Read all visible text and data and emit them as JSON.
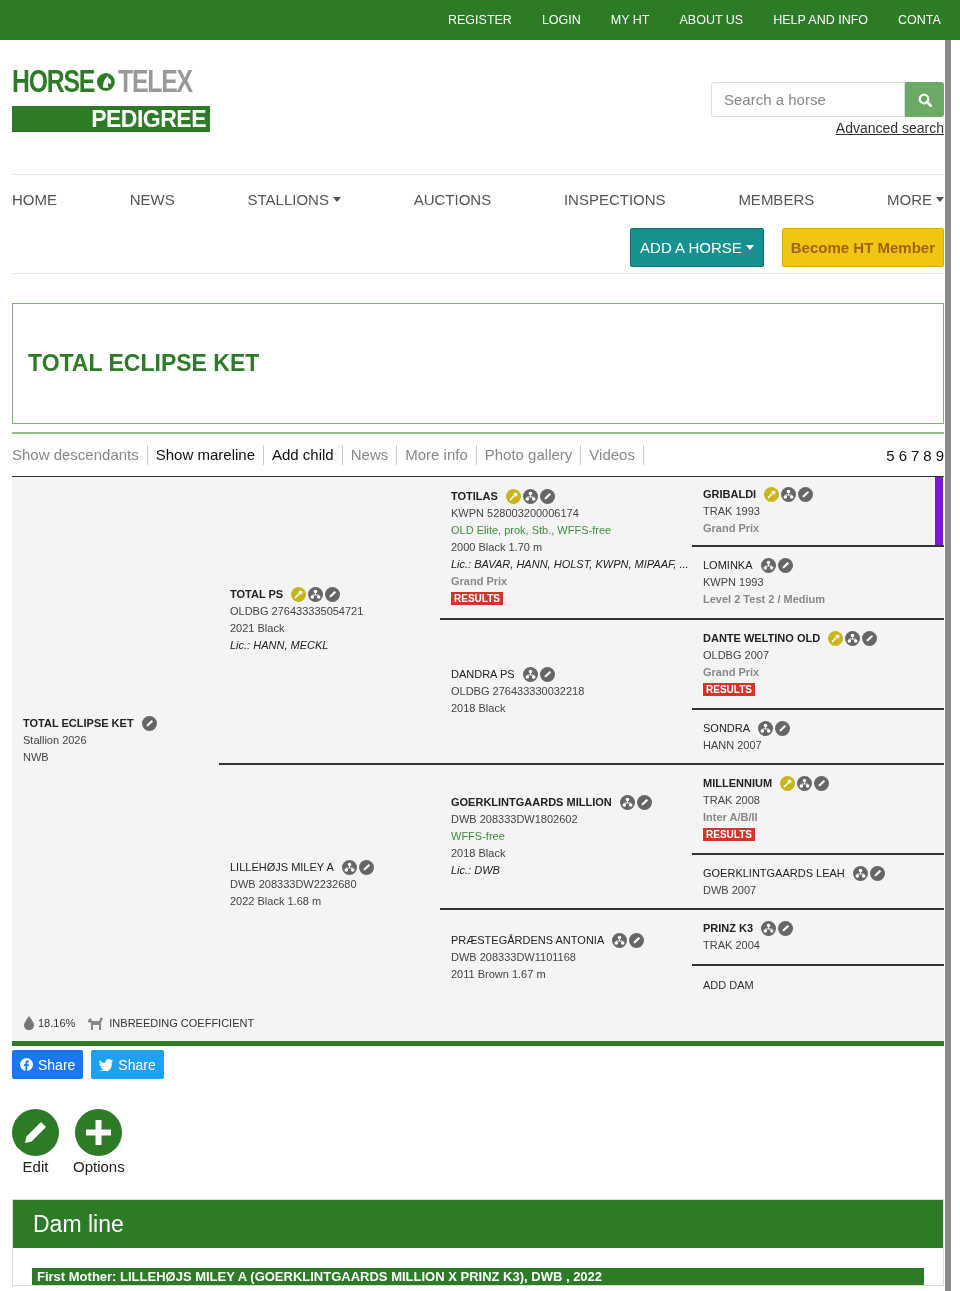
{
  "top_links": [
    "REGISTER",
    "LOGIN",
    "MY HT",
    "ABOUT US",
    "HELP AND INFO",
    "CONTA"
  ],
  "logo": {
    "word_1": "HORSE",
    "word_2": "TELEX",
    "tagline": "PEDIGREE"
  },
  "search": {
    "placeholder": "Search a horse",
    "advanced_link": "Advanced search"
  },
  "nav": [
    {
      "label": "HOME",
      "has_menu": false
    },
    {
      "label": "NEWS",
      "has_menu": false
    },
    {
      "label": "STALLIONS",
      "has_menu": true
    },
    {
      "label": "AUCTIONS",
      "has_menu": false
    },
    {
      "label": "INSPECTIONS",
      "has_menu": false
    },
    {
      "label": "MEMBERS",
      "has_menu": false
    },
    {
      "label": "MORE",
      "has_menu": true
    }
  ],
  "actions": [
    {
      "label": "ADD A HORSE",
      "kind": "primary",
      "has_menu": true
    },
    {
      "label": "Become HT Member",
      "kind": "member",
      "has_menu": false
    }
  ],
  "title": "TOTAL ECLIPSE KET",
  "tabs": [
    {
      "label": "Show descendants",
      "disabled": true
    },
    {
      "label": "Show mareline",
      "disabled": false
    },
    {
      "label": "Add child",
      "disabled": false
    },
    {
      "label": "News",
      "disabled": true
    },
    {
      "label": "More info",
      "disabled": true
    },
    {
      "label": "Photo gallery",
      "disabled": true
    },
    {
      "label": "Videos",
      "disabled": true
    }
  ],
  "generations": [
    "5",
    "6",
    "7",
    "8",
    "9"
  ],
  "pedigree": {
    "horse": {
      "kind": "stallion",
      "name": "TOTAL ECLIPSE KET",
      "approved": false,
      "offspring": false,
      "lines": [
        {
          "text": "Stallion 2026",
          "kind": "plain"
        },
        {
          "text": "NWB",
          "kind": "plain"
        }
      ],
      "children": [
        {
          "kind": "stallion",
          "name": "TOTAL PS",
          "approved": true,
          "offspring": true,
          "lines": [
            {
              "text": "OLDBG 276433335054721",
              "kind": "plain"
            },
            {
              "text": "2021 Black",
              "kind": "plain"
            },
            {
              "text": "Lic.: HANN, MECKL",
              "kind": "licence"
            }
          ],
          "children": [
            {
              "kind": "stallion",
              "name": "TOTILAS",
              "approved": true,
              "offspring": true,
              "lines": [
                {
                  "text": "KWPN 528003200006174",
                  "kind": "plain"
                },
                {
                  "text": "OLD Elite, prok, Stb., WFFS-free",
                  "kind": "predicate"
                },
                {
                  "text": "2000 Black 1.70 m",
                  "kind": "plain"
                },
                {
                  "text": "Lic.: BAVAR, HANN, HOLST, KWPN, MIPAAF, ...",
                  "kind": "licence"
                },
                {
                  "text": "Grand Prix",
                  "kind": "discipline"
                }
              ],
              "results": "RESULTS",
              "children": [
                {
                  "kind": "stallion",
                  "name": "GRIBALDI",
                  "approved": true,
                  "offspring": true,
                  "color": "#7b16d2",
                  "lines": [
                    {
                      "text": "TRAK 1993",
                      "kind": "plain"
                    },
                    {
                      "text": "Grand Prix",
                      "kind": "discipline"
                    }
                  ]
                },
                {
                  "kind": "mare",
                  "name": "LOMINKA",
                  "approved": false,
                  "offspring": true,
                  "lines": [
                    {
                      "text": "KWPN 1993",
                      "kind": "plain"
                    },
                    {
                      "text": "Level 2 Test 2 / Medium",
                      "kind": "discipline"
                    }
                  ]
                }
              ]
            },
            {
              "kind": "mare",
              "name": "DANDRA PS",
              "approved": false,
              "offspring": true,
              "lines": [
                {
                  "text": "OLDBG 276433330032218",
                  "kind": "plain"
                },
                {
                  "text": "2018 Black",
                  "kind": "plain"
                }
              ],
              "children": [
                {
                  "kind": "stallion",
                  "name": "DANTE WELTINO OLD",
                  "approved": true,
                  "offspring": true,
                  "lines": [
                    {
                      "text": "OLDBG 2007",
                      "kind": "plain"
                    },
                    {
                      "text": "Grand Prix",
                      "kind": "discipline"
                    }
                  ],
                  "results": "RESULTS"
                },
                {
                  "kind": "mare",
                  "name": "SONDRA",
                  "approved": false,
                  "offspring": true,
                  "lines": [
                    {
                      "text": "HANN 2007",
                      "kind": "plain"
                    }
                  ]
                }
              ]
            }
          ]
        },
        {
          "kind": "mare",
          "name": "LILLEHØJS MILEY A",
          "approved": false,
          "offspring": true,
          "lines": [
            {
              "text": "DWB 208333DW2232680",
              "kind": "plain"
            },
            {
              "text": "2022 Black 1.68 m",
              "kind": "plain"
            }
          ],
          "children": [
            {
              "kind": "stallion",
              "name": "GOERKLINTGAARDS MILLION",
              "approved": false,
              "offspring": true,
              "lines": [
                {
                  "text": "DWB 208333DW1802602",
                  "kind": "plain"
                },
                {
                  "text": "WFFS-free",
                  "kind": "predicate"
                },
                {
                  "text": "2018 Black",
                  "kind": "plain"
                },
                {
                  "text": "Lic.: DWB",
                  "kind": "licence"
                }
              ],
              "children": [
                {
                  "kind": "stallion",
                  "name": "MILLENNIUM",
                  "approved": true,
                  "offspring": true,
                  "lines": [
                    {
                      "text": "TRAK 2008",
                      "kind": "plain"
                    },
                    {
                      "text": "Inter A/B/II",
                      "kind": "discipline"
                    }
                  ],
                  "results": "RESULTS"
                },
                {
                  "kind": "mare",
                  "name": "GOERKLINTGAARDS LEAH",
                  "approved": false,
                  "offspring": true,
                  "lines": [
                    {
                      "text": "DWB 2007",
                      "kind": "plain"
                    }
                  ]
                }
              ]
            },
            {
              "kind": "mare",
              "name": "PRÆSTEGÅRDENS ANTONIA",
              "approved": false,
              "offspring": true,
              "lines": [
                {
                  "text": "DWB 208333DW1101168",
                  "kind": "plain"
                },
                {
                  "text": "2011 Brown 1.67 m",
                  "kind": "plain"
                }
              ],
              "children": [
                {
                  "kind": "stallion",
                  "name": "PRINZ K3",
                  "approved": false,
                  "offspring": true,
                  "lines": [
                    {
                      "text": "TRAK 2004",
                      "kind": "plain"
                    }
                  ]
                },
                {
                  "kind": "add",
                  "name": "ADD DAM"
                }
              ]
            }
          ]
        }
      ]
    },
    "inbreeding": {
      "value": "18.16%",
      "label": "INBREEDING COEFFICIENT"
    }
  },
  "share": [
    {
      "label": "Share",
      "kind": "facebook"
    },
    {
      "label": "Share",
      "kind": "twitter"
    }
  ],
  "tools": [
    {
      "label": "Edit",
      "kind": "edit"
    },
    {
      "label": "Options",
      "kind": "options"
    }
  ],
  "dam_line": {
    "title": "Dam line",
    "first_mother": "First Mother: LILLEHØJS MILEY A (GOERKLINTGAARDS MILLION X PRINZ K3), DWB , 2022"
  }
}
